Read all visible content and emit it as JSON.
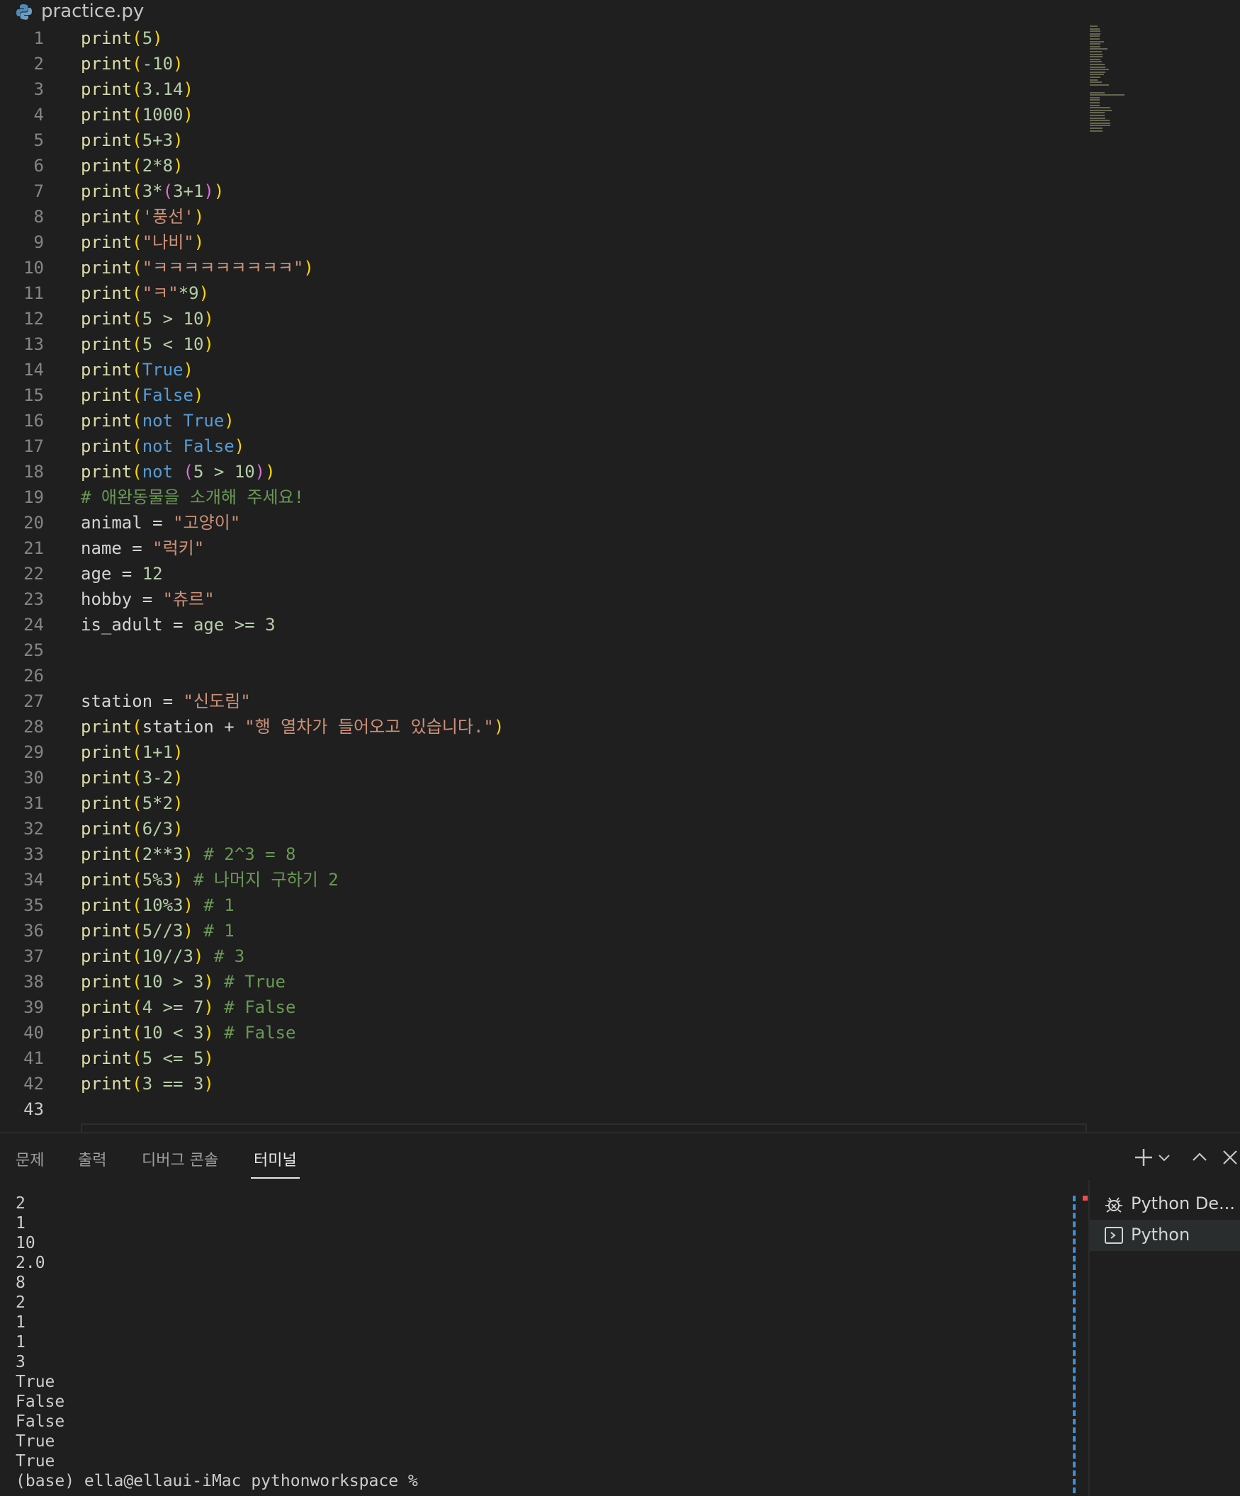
{
  "editor": {
    "tab_title": "practice.py",
    "active_line": 43,
    "lines": [
      [
        [
          "print",
          "fn"
        ],
        [
          "(",
          "p1"
        ],
        [
          "5",
          "num"
        ],
        [
          ")",
          "p1"
        ]
      ],
      [
        [
          "print",
          "fn"
        ],
        [
          "(",
          "p1"
        ],
        [
          "-10",
          "num"
        ],
        [
          ")",
          "p1"
        ]
      ],
      [
        [
          "print",
          "fn"
        ],
        [
          "(",
          "p1"
        ],
        [
          "3.14",
          "num"
        ],
        [
          ")",
          "p1"
        ]
      ],
      [
        [
          "print",
          "fn"
        ],
        [
          "(",
          "p1"
        ],
        [
          "1000",
          "num"
        ],
        [
          ")",
          "p1"
        ]
      ],
      [
        [
          "print",
          "fn"
        ],
        [
          "(",
          "p1"
        ],
        [
          "5+3",
          "num"
        ],
        [
          ")",
          "p1"
        ]
      ],
      [
        [
          "print",
          "fn"
        ],
        [
          "(",
          "p1"
        ],
        [
          "2*8",
          "num"
        ],
        [
          ")",
          "p1"
        ]
      ],
      [
        [
          "print",
          "fn"
        ],
        [
          "(",
          "p1"
        ],
        [
          "3*",
          "num"
        ],
        [
          "(",
          "p2"
        ],
        [
          "3+1",
          "num"
        ],
        [
          ")",
          "p2"
        ],
        [
          ")",
          "p1"
        ]
      ],
      [
        [
          "print",
          "fn"
        ],
        [
          "(",
          "p1"
        ],
        [
          "'풍선'",
          "str"
        ],
        [
          ")",
          "p1"
        ]
      ],
      [
        [
          "print",
          "fn"
        ],
        [
          "(",
          "p1"
        ],
        [
          "\"나비\"",
          "str"
        ],
        [
          ")",
          "p1"
        ]
      ],
      [
        [
          "print",
          "fn"
        ],
        [
          "(",
          "p1"
        ],
        [
          "\"ㅋㅋㅋㅋㅋㅋㅋㅋㅋ\"",
          "str"
        ],
        [
          ")",
          "p1"
        ]
      ],
      [
        [
          "print",
          "fn"
        ],
        [
          "(",
          "p1"
        ],
        [
          "\"ㅋ\"",
          "str"
        ],
        [
          "*9",
          "num"
        ],
        [
          ")",
          "p1"
        ]
      ],
      [
        [
          "print",
          "fn"
        ],
        [
          "(",
          "p1"
        ],
        [
          "5 > 10",
          "num"
        ],
        [
          ")",
          "p1"
        ]
      ],
      [
        [
          "print",
          "fn"
        ],
        [
          "(",
          "p1"
        ],
        [
          "5 < 10",
          "num"
        ],
        [
          ")",
          "p1"
        ]
      ],
      [
        [
          "print",
          "fn"
        ],
        [
          "(",
          "p1"
        ],
        [
          "True",
          "kw"
        ],
        [
          ")",
          "p1"
        ]
      ],
      [
        [
          "print",
          "fn"
        ],
        [
          "(",
          "p1"
        ],
        [
          "False",
          "kw"
        ],
        [
          ")",
          "p1"
        ]
      ],
      [
        [
          "print",
          "fn"
        ],
        [
          "(",
          "p1"
        ],
        [
          "not ",
          "kw"
        ],
        [
          "True",
          "kw"
        ],
        [
          ")",
          "p1"
        ]
      ],
      [
        [
          "print",
          "fn"
        ],
        [
          "(",
          "p1"
        ],
        [
          "not ",
          "kw"
        ],
        [
          "False",
          "kw"
        ],
        [
          ")",
          "p1"
        ]
      ],
      [
        [
          "print",
          "fn"
        ],
        [
          "(",
          "p1"
        ],
        [
          "not ",
          "kw"
        ],
        [
          "(",
          "p2"
        ],
        [
          "5 > 10",
          "num"
        ],
        [
          ")",
          "p2"
        ],
        [
          ")",
          "p1"
        ]
      ],
      [
        [
          "# 애완동물을 소개해 주세요!",
          "cmt"
        ]
      ],
      [
        [
          "animal",
          "op"
        ],
        [
          " = ",
          "op"
        ],
        [
          "\"고양이\"",
          "str"
        ]
      ],
      [
        [
          "name",
          "op"
        ],
        [
          " = ",
          "op"
        ],
        [
          "\"럭키\"",
          "str"
        ]
      ],
      [
        [
          "age",
          "op"
        ],
        [
          " = ",
          "op"
        ],
        [
          "12",
          "num"
        ]
      ],
      [
        [
          "hobby",
          "op"
        ],
        [
          " = ",
          "op"
        ],
        [
          "\"츄르\"",
          "str"
        ]
      ],
      [
        [
          "is_adult",
          "op"
        ],
        [
          " = ",
          "op"
        ],
        [
          "age >= 3",
          "num"
        ]
      ],
      [],
      [],
      [
        [
          "station",
          "op"
        ],
        [
          " = ",
          "op"
        ],
        [
          "\"신도림\"",
          "str"
        ]
      ],
      [
        [
          "print",
          "fn"
        ],
        [
          "(",
          "p1"
        ],
        [
          "station + ",
          "op"
        ],
        [
          "\"행 열차가 들어오고 있습니다.\"",
          "str"
        ],
        [
          ")",
          "p1"
        ]
      ],
      [
        [
          "print",
          "fn"
        ],
        [
          "(",
          "p1"
        ],
        [
          "1+1",
          "num"
        ],
        [
          ")",
          "p1"
        ]
      ],
      [
        [
          "print",
          "fn"
        ],
        [
          "(",
          "p1"
        ],
        [
          "3-2",
          "num"
        ],
        [
          ")",
          "p1"
        ]
      ],
      [
        [
          "print",
          "fn"
        ],
        [
          "(",
          "p1"
        ],
        [
          "5*2",
          "num"
        ],
        [
          ")",
          "p1"
        ]
      ],
      [
        [
          "print",
          "fn"
        ],
        [
          "(",
          "p1"
        ],
        [
          "6/3",
          "num"
        ],
        [
          ")",
          "p1"
        ]
      ],
      [
        [
          "print",
          "fn"
        ],
        [
          "(",
          "p1"
        ],
        [
          "2**3",
          "num"
        ],
        [
          ")",
          "p1"
        ],
        [
          " # 2^3 = 8",
          "cmt"
        ]
      ],
      [
        [
          "print",
          "fn"
        ],
        [
          "(",
          "p1"
        ],
        [
          "5%3",
          "num"
        ],
        [
          ")",
          "p1"
        ],
        [
          " # 나머지 구하기 2",
          "cmt"
        ]
      ],
      [
        [
          "print",
          "fn"
        ],
        [
          "(",
          "p1"
        ],
        [
          "10%3",
          "num"
        ],
        [
          ")",
          "p1"
        ],
        [
          " # 1",
          "cmt"
        ]
      ],
      [
        [
          "print",
          "fn"
        ],
        [
          "(",
          "p1"
        ],
        [
          "5//3",
          "num"
        ],
        [
          ")",
          "p1"
        ],
        [
          " # 1",
          "cmt"
        ]
      ],
      [
        [
          "print",
          "fn"
        ],
        [
          "(",
          "p1"
        ],
        [
          "10//3",
          "num"
        ],
        [
          ")",
          "p1"
        ],
        [
          " # 3",
          "cmt"
        ]
      ],
      [
        [
          "print",
          "fn"
        ],
        [
          "(",
          "p1"
        ],
        [
          "10 > 3",
          "num"
        ],
        [
          ")",
          "p1"
        ],
        [
          " # True",
          "cmt"
        ]
      ],
      [
        [
          "print",
          "fn"
        ],
        [
          "(",
          "p1"
        ],
        [
          "4 >= 7",
          "num"
        ],
        [
          ")",
          "p1"
        ],
        [
          " # False",
          "cmt"
        ]
      ],
      [
        [
          "print",
          "fn"
        ],
        [
          "(",
          "p1"
        ],
        [
          "10 < 3",
          "num"
        ],
        [
          ")",
          "p1"
        ],
        [
          " # False",
          "cmt"
        ]
      ],
      [
        [
          "print",
          "fn"
        ],
        [
          "(",
          "p1"
        ],
        [
          "5 <= 5",
          "num"
        ],
        [
          ")",
          "p1"
        ]
      ],
      [
        [
          "print",
          "fn"
        ],
        [
          "(",
          "p1"
        ],
        [
          "3 == 3",
          "num"
        ],
        [
          ")",
          "p1"
        ]
      ],
      []
    ]
  },
  "panel": {
    "tabs": [
      "문제",
      "출력",
      "디버그 콘솔",
      "터미널"
    ],
    "active_tab": "터미널",
    "actions": {
      "new_terminal": "+",
      "dropdown": "⌄",
      "maximize": "^",
      "close": "×"
    }
  },
  "terminal": {
    "output": [
      "2",
      "1",
      "10",
      "2.0",
      "8",
      "2",
      "1",
      "1",
      "3",
      "True",
      "False",
      "False",
      "True",
      "True"
    ],
    "prompt": "(base) ella@ellaui-iMac pythonworkspace %"
  },
  "terminal_list": [
    {
      "label": "Python De...",
      "icon": "debug-icon",
      "selected": false
    },
    {
      "label": "Python",
      "icon": "terminal-icon",
      "selected": true
    }
  ],
  "colors": {
    "background": "#1f1f1f",
    "function": "#dcdcaa",
    "string": "#ce9178",
    "keyword": "#569cd6",
    "number": "#b5cea8",
    "comment": "#6a9955",
    "bracket_1": "#ffd700",
    "bracket_2": "#da70d6",
    "terminal_marker": "#3a8fd6"
  }
}
